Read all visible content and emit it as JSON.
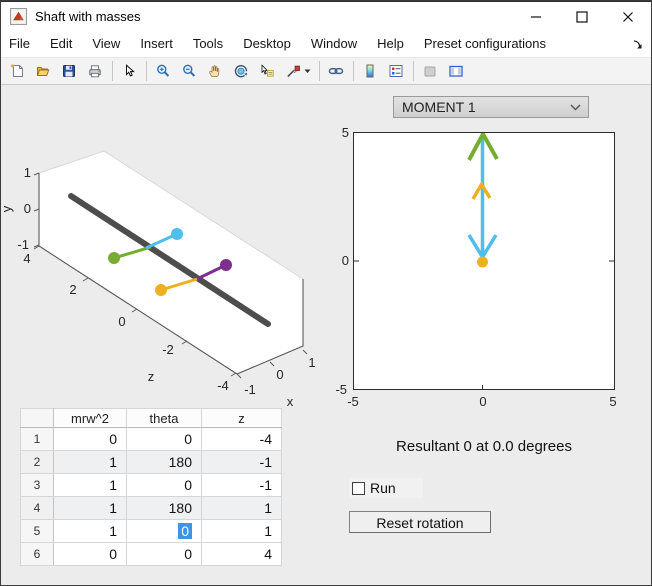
{
  "window": {
    "title": "Shaft with masses",
    "controls": [
      "minimize",
      "maximize",
      "close"
    ]
  },
  "menu": {
    "items": [
      "File",
      "Edit",
      "View",
      "Insert",
      "Tools",
      "Desktop",
      "Window",
      "Help",
      "Preset configurations"
    ]
  },
  "toolbar": {
    "buttons": [
      "new-figure",
      "open-file",
      "save-figure",
      "print-figure",
      "edit-plot",
      "zoom-in",
      "zoom-out",
      "pan",
      "rotate-3d",
      "data-cursor",
      "brush-data",
      "link-plots",
      "insert-colorbar",
      "insert-legend",
      "hide-plot-tools",
      "show-plot-tools"
    ]
  },
  "moment_selector": {
    "value": "MOMENT 1"
  },
  "left_plot": {
    "xlabel": "x",
    "ylabel": "y",
    "zlabel": "z",
    "yticks": [
      "1",
      "0",
      "-1"
    ],
    "zticks": [
      "4",
      "2",
      "0",
      "-2",
      "-4"
    ],
    "xticks": [
      "-1",
      "0",
      "1"
    ]
  },
  "right_plot": {
    "yticks": [
      "5",
      "0",
      "-5"
    ],
    "xticks": [
      "-5",
      "0",
      "5"
    ]
  },
  "resultant_text": "Resultant 0 at 0.0 degrees",
  "run_checkbox": {
    "label": "Run",
    "checked": false
  },
  "reset_button": {
    "label": "Reset rotation"
  },
  "mass_table": {
    "columns": [
      "mrw^2",
      "theta",
      "z"
    ],
    "rows": [
      {
        "n": "1",
        "v": [
          "0",
          "0",
          "-4"
        ]
      },
      {
        "n": "2",
        "v": [
          "1",
          "180",
          "-1"
        ]
      },
      {
        "n": "3",
        "v": [
          "1",
          "0",
          "-1"
        ]
      },
      {
        "n": "4",
        "v": [
          "1",
          "180",
          "1"
        ]
      },
      {
        "n": "5",
        "v": [
          "1",
          "0",
          "1"
        ]
      },
      {
        "n": "6",
        "v": [
          "0",
          "0",
          "4"
        ]
      }
    ],
    "selected_cell": {
      "row": 5,
      "column": "theta",
      "value": "0"
    }
  },
  "colors": {
    "cyan": "#4DBEEE",
    "green": "#77AC30",
    "orange": "#EDB120",
    "purple": "#7E2F8E",
    "shaft": "#4D4D4D",
    "selection": "#3E95E8"
  },
  "chart_data": [
    {
      "type": "scatter",
      "title": "3-D shaft with attached masses",
      "axis_ranges": {
        "x": [
          -1,
          1
        ],
        "y": [
          -1,
          1
        ],
        "z": [
          -4,
          4
        ]
      },
      "shaft": {
        "from_z": -4,
        "to_z": 4,
        "color": "#4D4D4D"
      },
      "masses": [
        {
          "mrw2": 1,
          "theta": 180,
          "z": -1,
          "color": "#EDB120"
        },
        {
          "mrw2": 1,
          "theta": 0,
          "z": -1,
          "color": "#7E2F8E"
        },
        {
          "mrw2": 1,
          "theta": 180,
          "z": 1,
          "color": "#77AC30"
        },
        {
          "mrw2": 1,
          "theta": 0,
          "z": 1,
          "color": "#4DBEEE"
        }
      ]
    },
    {
      "type": "line",
      "title": "MOMENT 1",
      "xlim": [
        -5,
        5
      ],
      "ylim": [
        -5,
        5
      ],
      "vectors": [
        {
          "name": "green-moment",
          "from": [
            0,
            0
          ],
          "to": [
            0,
            5
          ],
          "direction": "up",
          "color": "#77AC30"
        },
        {
          "name": "orange-moment",
          "from": [
            0,
            0
          ],
          "to": [
            0,
            3
          ],
          "direction": "up",
          "color": "#EDB120"
        },
        {
          "name": "cyan-resultant",
          "from": [
            0,
            5
          ],
          "to": [
            0,
            0
          ],
          "direction": "down",
          "color": "#4DBEEE"
        }
      ],
      "origin_marker": {
        "x": 0,
        "y": 0,
        "color": "#EDB120"
      }
    }
  ]
}
